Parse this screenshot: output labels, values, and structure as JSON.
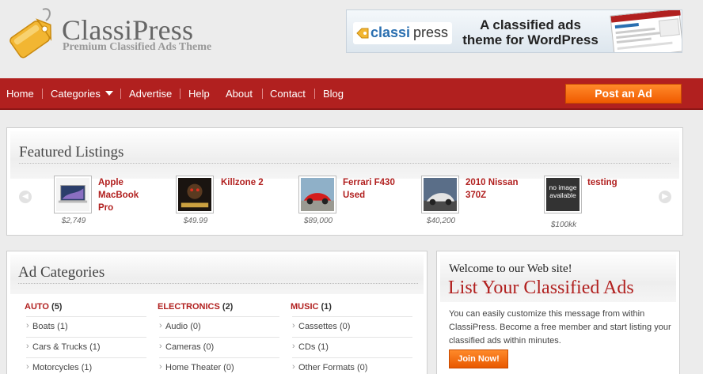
{
  "header": {
    "logo_title": "ClassiPress",
    "logo_subtitle": "Premium Classified Ads Theme",
    "banner": {
      "logo_classi": "classi",
      "logo_press": "press",
      "text": "A classified ads theme for WordPress"
    }
  },
  "nav": {
    "items": [
      "Home",
      "Categories",
      "Advertise",
      "Help",
      "About",
      "Contact",
      "Blog"
    ],
    "post_ad_label": "Post an Ad"
  },
  "featured": {
    "title": "Featured Listings",
    "listings": [
      {
        "title": "Apple MacBook Pro",
        "price": "$2,749"
      },
      {
        "title": "Killzone 2",
        "price": "$49.99"
      },
      {
        "title": "Ferrari F430 Used",
        "price": "$89,000"
      },
      {
        "title": "2010 Nissan 370Z",
        "price": "$40,200"
      },
      {
        "title": "testing",
        "price": "$100kk",
        "thumb_text": "no image available"
      }
    ]
  },
  "ad_categories": {
    "title": "Ad Categories",
    "columns": [
      {
        "name": "AUTO",
        "count": "(5)",
        "items": [
          "Boats (1)",
          "Cars & Trucks (1)",
          "Motorcycles (1)"
        ]
      },
      {
        "name": "ELECTRONICS",
        "count": "(2)",
        "items": [
          "Audio (0)",
          "Cameras (0)",
          "Home Theater (0)"
        ]
      },
      {
        "name": "MUSIC",
        "count": "(1)",
        "items": [
          "Cassettes (0)",
          "CDs (1)",
          "Other Formats (0)"
        ]
      }
    ]
  },
  "welcome": {
    "small_title": "Welcome to our Web site!",
    "big_title": "List Your Classified Ads",
    "body": "You can easily customize this message from within ClassiPress. Become a free member and start listing your classified ads within minutes.",
    "join_label": "Join Now!"
  },
  "icons": {
    "logo": "price-tag-icon",
    "prev": "chevron-left-icon",
    "next": "chevron-right-icon",
    "dropdown": "caret-down-icon"
  },
  "colors": {
    "brand_red": "#b1201f",
    "accent_orange": "#f26b0f"
  }
}
